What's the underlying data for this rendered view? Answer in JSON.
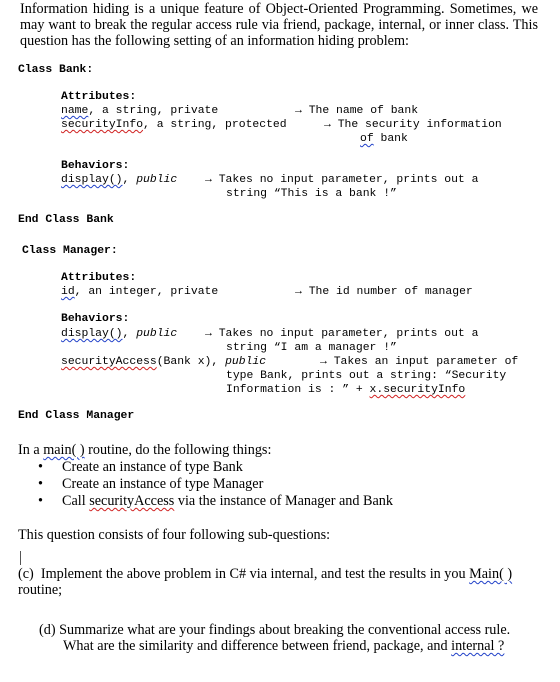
{
  "intro": "Information hiding is a unique feature of Object-Oriented Programming. Sometimes, we may want to break the regular access rule via friend, package, internal, or inner class. This question has the following setting of an information hiding problem:",
  "bank": {
    "header": "Class Bank:",
    "attributes_label": "Attributes:",
    "attributes": [
      {
        "name": "name",
        "rest": ", a string, private",
        "desc": "The name of bank",
        "desc2": ""
      },
      {
        "name": "securityInfo",
        "rest": ", a string, protected",
        "desc": "The security information",
        "desc2_first": "of",
        "desc2_rest": " bank"
      }
    ],
    "behaviors_label": "Behaviors:",
    "behaviors": [
      {
        "name": "display()",
        "rest_pre": ", ",
        "modifier": "public",
        "desc": "Takes no input parameter, prints out a",
        "desc2": "string “This is a bank !”"
      }
    ],
    "footer": "End Class Bank"
  },
  "manager": {
    "header": "Class Manager:",
    "attributes_label": "Attributes:",
    "attributes": [
      {
        "name": "id",
        "rest": ", an integer, private",
        "desc": "The id number of manager"
      }
    ],
    "behaviors_label": "Behaviors:",
    "behaviors": [
      {
        "name": "display()",
        "rest_pre": ", ",
        "modifier": "public",
        "desc": "Takes no input parameter, prints out a",
        "desc2": "string “I am a manager !”"
      },
      {
        "name": "securityAccess",
        "rest_pre": "(Bank x), ",
        "modifier": "public",
        "desc": "Takes an input parameter of",
        "desc2": "type Bank, prints out a string: “Security",
        "desc3_pre": "Information is : ” + ",
        "desc3_code": "x.securityInfo"
      }
    ],
    "footer": "End Class Manager"
  },
  "arrow": "→",
  "main_routine": {
    "pre": "In a ",
    "fn": "main( )",
    "post": " routine,  do the following things:",
    "bullet": "•",
    "items": [
      {
        "text": "Create an instance of type Bank"
      },
      {
        "text": "Create an instance of type Manager"
      },
      {
        "pre": "Call ",
        "code": "securityAccess",
        "post": " via the instance of Manager and Bank"
      }
    ]
  },
  "subquestions_intro": "This question consists of four following sub-questions:",
  "sub_c": {
    "label": "(c)",
    "text_pre": "Implement the above problem in C# via internal, and test the results in you ",
    "fn": "Main( )",
    "line2": "routine;"
  },
  "sub_d": {
    "label": "(d)",
    "line1": "Summarize what are your findings about breaking the conventional access rule.",
    "line2_pre": "What are the similarity and difference between friend, package, and ",
    "line2_word": "internal ?"
  }
}
